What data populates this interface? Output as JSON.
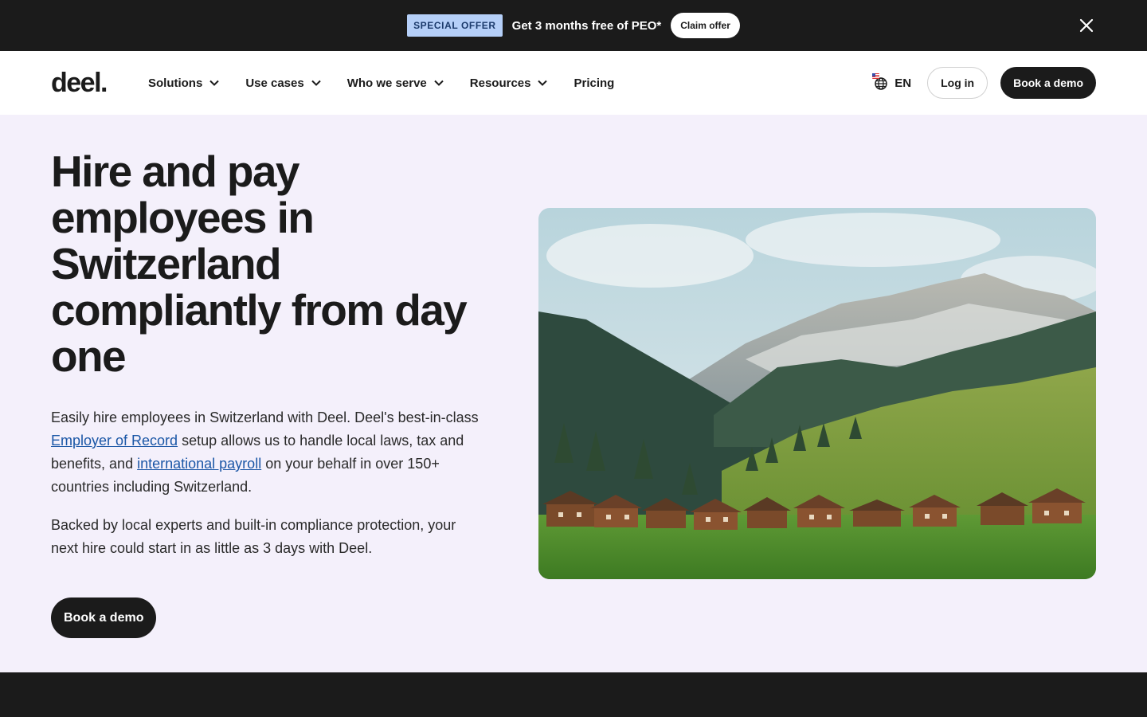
{
  "promo": {
    "badge": "SPECIAL OFFER",
    "text": "Get 3 months free of PEO*",
    "cta": "Claim offer"
  },
  "nav": {
    "logo": "deel.",
    "items": [
      {
        "label": "Solutions",
        "dropdown": true
      },
      {
        "label": "Use cases",
        "dropdown": true
      },
      {
        "label": "Who we serve",
        "dropdown": true
      },
      {
        "label": "Resources",
        "dropdown": true
      },
      {
        "label": "Pricing",
        "dropdown": false
      }
    ],
    "language": "EN",
    "login": "Log in",
    "book_demo": "Book a demo"
  },
  "hero": {
    "title": "Hire and pay employees in Switzerland compliantly from day one",
    "p1_before": "Easily hire employees in Switzerland with Deel. Deel's best-in-class ",
    "p1_link1": "Employer of Record",
    "p1_middle": " setup allows us to handle local laws, tax and benefits, and ",
    "p1_link2": "international payroll",
    "p1_after": " on your behalf in over 150+ countries including Switzerland.",
    "p2": "Backed by local experts and built-in compliance protection, your next hire could start in as little as 3 days with Deel.",
    "cta": "Book a demo"
  },
  "colors": {
    "dark": "#1b1b1b",
    "hero_bg": "#f4f0fb",
    "badge_bg": "#b5cff8",
    "link": "#1a56a6"
  },
  "icons": {
    "close": "close-icon",
    "chevron": "chevron-down-icon",
    "globe": "globe-icon"
  }
}
